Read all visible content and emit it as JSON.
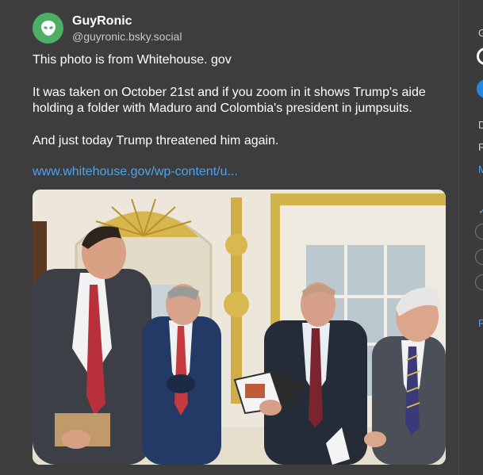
{
  "post": {
    "display_name": "GuyRonic",
    "handle": "@guyronic.bsky.social",
    "paragraphs": [
      "This photo is from Whitehouse. gov",
      "It was taken on October 21st and if you zoom in it shows Trump's aide holding a folder with Maduro and Colombia's president in jumpsuits.",
      "And just today Trump threatened him again."
    ],
    "link_text": "www.whitehouse.gov/wp-content/u..."
  },
  "sidebar": {
    "fragments": [
      "G",
      "D",
      "F",
      "M",
      "F"
    ]
  },
  "colors": {
    "background": "#3d3d3d",
    "avatar": "#4caf64",
    "link": "#4ea3f0",
    "accent": "#1e88e5"
  }
}
